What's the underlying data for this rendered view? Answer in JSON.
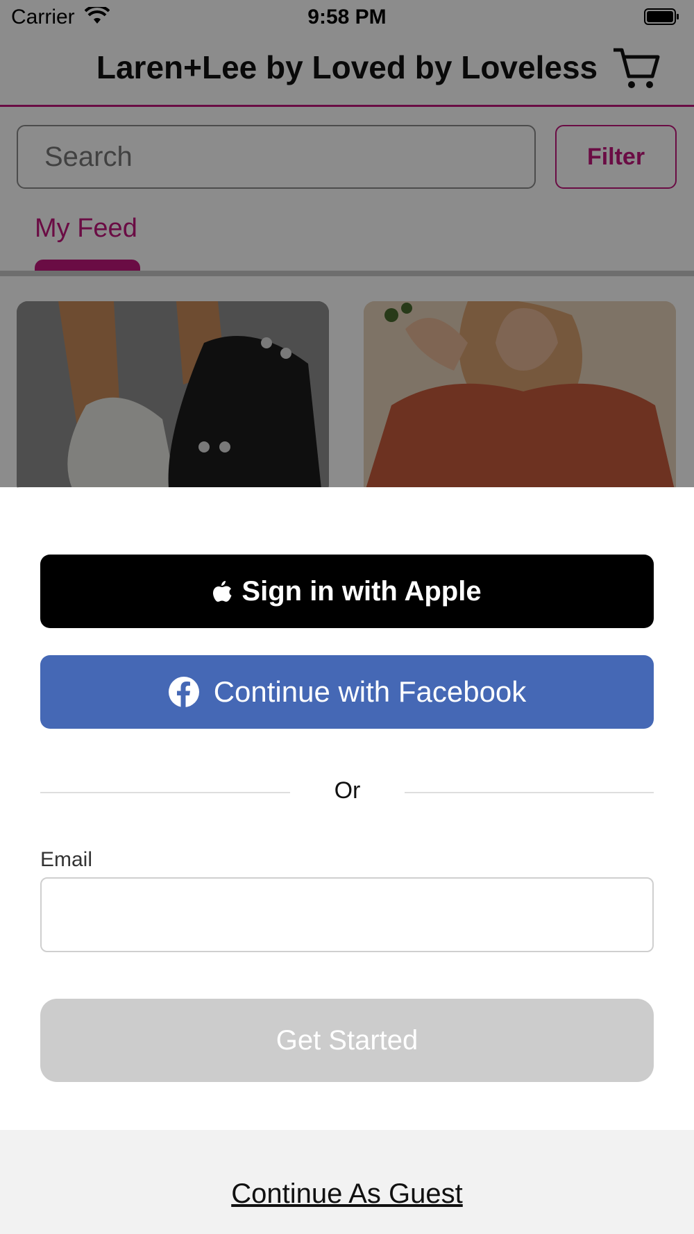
{
  "status_bar": {
    "carrier": "Carrier",
    "time": "9:58 PM"
  },
  "header": {
    "title": "Laren+Lee by Loved by Loveless"
  },
  "search": {
    "placeholder": "Search",
    "filter_label": "Filter"
  },
  "tabs": [
    {
      "label": "My Feed",
      "active": true
    }
  ],
  "feed_cards": [
    {
      "image": "boots-photo"
    },
    {
      "image": "rust-top-photo"
    }
  ],
  "sheet": {
    "apple_button": "Sign in with Apple",
    "facebook_button": "Continue with Facebook",
    "divider_text": "Or",
    "email_label": "Email",
    "email_value": "",
    "get_started": "Get Started",
    "guest_link": "Continue As Guest"
  },
  "colors": {
    "accent": "#c2177d",
    "facebook": "#4568b5",
    "disabled": "#cccccc"
  }
}
